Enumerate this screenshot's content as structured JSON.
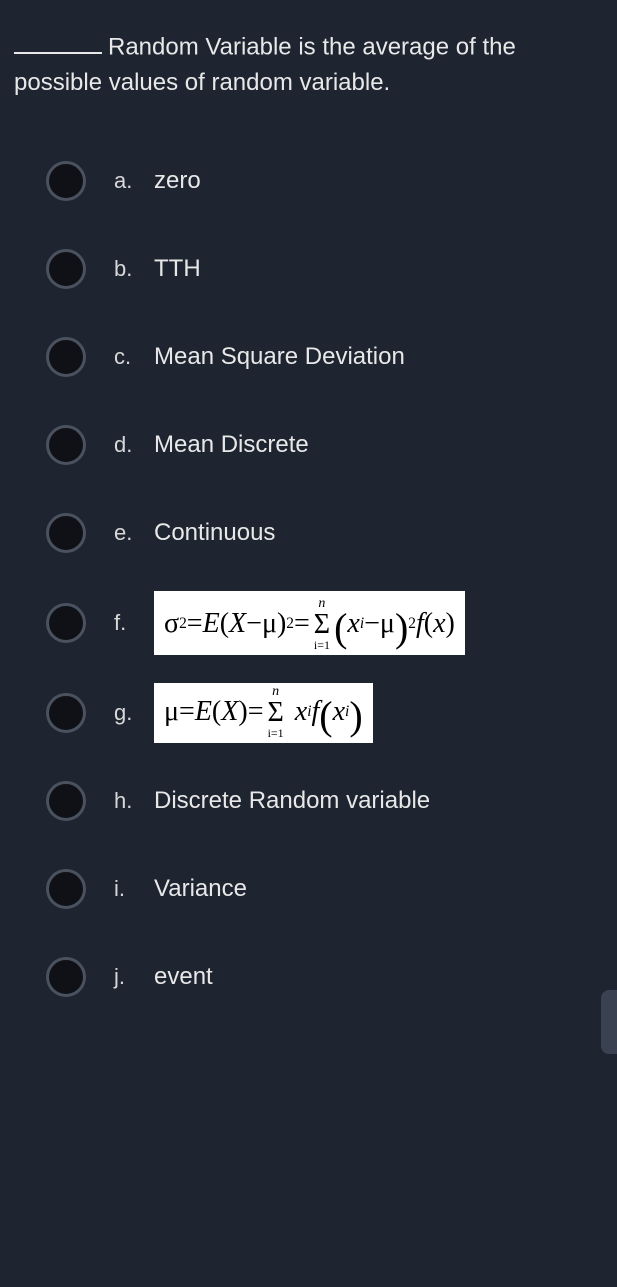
{
  "question": {
    "after_blank": "Random Variable is the average of the possible values of random variable."
  },
  "options": {
    "a": {
      "letter": "a.",
      "text": "zero"
    },
    "b": {
      "letter": "b.",
      "text": "TTH"
    },
    "c": {
      "letter": "c.",
      "text": "Mean Square Deviation"
    },
    "d": {
      "letter": "d.",
      "text": "Mean Discrete"
    },
    "e": {
      "letter": "e.",
      "text": "Continuous"
    },
    "f": {
      "letter": "f.",
      "formula": {
        "lhs_var": "σ",
        "lhs_sup": "2",
        "eq1": " = ",
        "E": "E",
        "open": "(",
        "X": "X",
        "minus": " − ",
        "mu": "μ",
        "close": ")",
        "sup2": "2",
        "eq2": " = ",
        "sum_top": "n",
        "sum_sym": "Σ",
        "sum_bot": "i=1",
        "term_open": "(",
        "xi_x": "x",
        "xi_sub": "i",
        "term_minus": " − ",
        "term_mu": "μ",
        "term_close": ")",
        "term_sup": "2",
        "fx_f": "f",
        "fx_open": "(",
        "fx_x": "x",
        "fx_close": ")"
      }
    },
    "g": {
      "letter": "g.",
      "formula": {
        "mu": "μ",
        "eq1": " = ",
        "E": "E",
        "open": "(",
        "X": "X",
        "close": ")",
        "eq2": " = ",
        "sum_top": "n",
        "sum_sym": "Σ",
        "sum_bot": "i=1",
        "xi_x": "x",
        "xi_sub": "i",
        "fx_f": "f",
        "fx_x": "x",
        "fx_sub": "i"
      }
    },
    "h": {
      "letter": "h.",
      "text": "Discrete Random variable"
    },
    "i": {
      "letter": "i.",
      "text": "Variance"
    },
    "j": {
      "letter": "j.",
      "text": "event"
    }
  }
}
